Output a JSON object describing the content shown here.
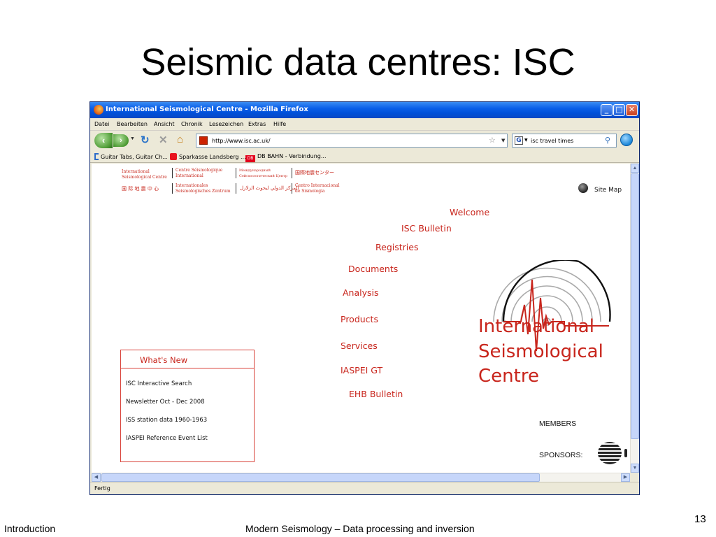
{
  "slide": {
    "title": "Seismic data centres: ISC",
    "footer_left": "Introduction",
    "footer_center": "Modern Seismology – Data processing and inversion",
    "page_number": "13"
  },
  "browser": {
    "window_title": "International Seismological Centre - Mozilla Firefox",
    "controls": {
      "minimize": "_",
      "maximize": "□",
      "close": "✕"
    },
    "menu": [
      "Datei",
      "Bearbeiten",
      "Ansicht",
      "Chronik",
      "Lesezeichen",
      "Extras",
      "Hilfe"
    ],
    "url": "http://www.isc.ac.uk/",
    "search_engine": "G",
    "search_value": "isc travel times",
    "bookmarks": [
      "Guitar Tabs, Guitar Ch...",
      "Sparkasse Landsberg ...",
      "DB BAHN - Verbindung..."
    ],
    "bookmark_badge": "DB",
    "status": "Fertig"
  },
  "page": {
    "languages": {
      "en": "International\nSeismological Centre",
      "fr": "Centre Séismologique\nInternational",
      "ru": "Международный\nСейсмологический Центр",
      "ja": "国際地震センター",
      "zh": "国 际 地 震 中 心",
      "de": "Internationales\nSeismologisches Zentrum",
      "ar": "المركز الدولي لبحوث الزلازل",
      "es": "Centro Internacional\nde Sismologia"
    },
    "site_map": "Site Map",
    "nav": [
      "Welcome",
      "ISC Bulletin",
      "Registries",
      "Documents",
      "Analysis",
      "Products",
      "Services",
      "IASPEI GT",
      "EHB Bulletin"
    ],
    "logo_lines": [
      "International",
      "Seismological",
      "Centre"
    ],
    "whats_new": {
      "title": "What's New",
      "items": [
        "ISC Interactive Search",
        "Newsletter Oct - Dec 2008",
        "ISS station data 1960-1963",
        "IASPEI Reference Event List"
      ]
    },
    "members": "MEMBERS",
    "sponsors": "SPONSORS:"
  },
  "colors": {
    "accent": "#c8251c",
    "titlebar": "#0a5ee8"
  }
}
